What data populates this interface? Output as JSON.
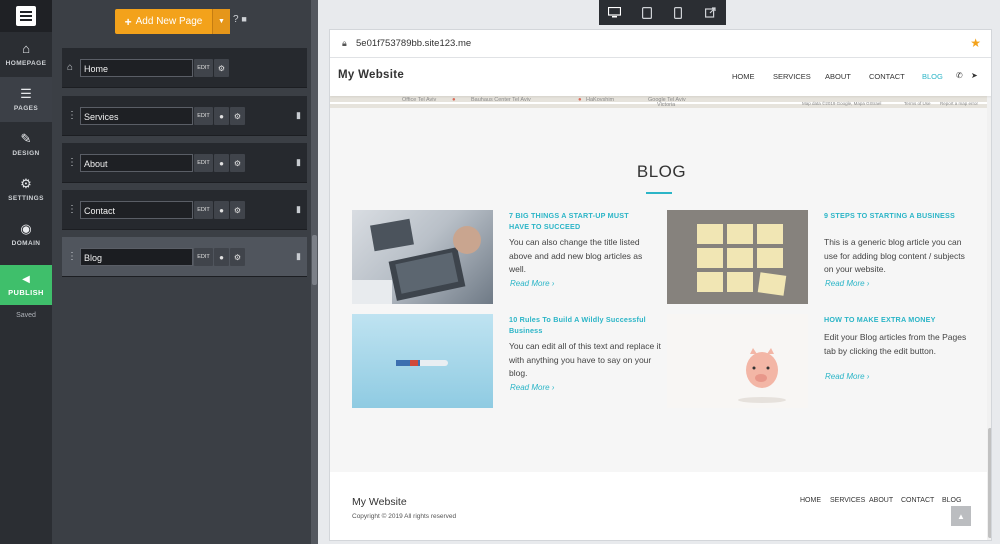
{
  "rail": {
    "items": [
      {
        "label": "HOMEPAGE",
        "icon": "home-icon"
      },
      {
        "label": "PAGES",
        "icon": "pages-icon"
      },
      {
        "label": "DESIGN",
        "icon": "brush-icon"
      },
      {
        "label": "SETTINGS",
        "icon": "gear-icon"
      },
      {
        "label": "DOMAIN",
        "icon": "globe-icon"
      }
    ],
    "publish_label": "PUBLISH",
    "saved_label": "Saved"
  },
  "pages_panel": {
    "add_label": "Add New Page",
    "edit_label": "EDIT",
    "pages": [
      {
        "name": "Home"
      },
      {
        "name": "Services"
      },
      {
        "name": "About"
      },
      {
        "name": "Contact"
      },
      {
        "name": "Blog"
      }
    ]
  },
  "browser": {
    "url": "5e01f753789bb.site123.me"
  },
  "site": {
    "title": "My Website",
    "nav": [
      "HOME",
      "SERVICES",
      "ABOUT",
      "CONTACT",
      "BLOG"
    ],
    "map_labels": [
      "Office Tel Aviv",
      "Bauhaus Center Tel Aviv",
      "HaKovshim",
      "Google Tel Aviv",
      "Victoria",
      "Map data ©2019 Google, Mapa GISrael",
      "Terms of Use",
      "Report a map error"
    ],
    "blog_heading": "BLOG",
    "posts": [
      {
        "title": "7 BIG THINGS A START-UP MUST HAVE TO SUCCEED",
        "body": "You can also change the title listed above and add new blog articles as well.",
        "more": "Read More ›"
      },
      {
        "title": "9 STEPS TO STARTING A BUSINESS",
        "body": "This is a generic blog article you can use for adding blog content / subjects on your website.",
        "more": "Read More ›"
      },
      {
        "title": "10 Rules To Build A Wildly Successful Business",
        "body": "You can edit all of this text and replace it with anything you have to say on your blog.",
        "more": "Read More ›"
      },
      {
        "title": "HOW TO MAKE EXTRA MONEY",
        "body": "Edit your Blog articles from the Pages tab by clicking the edit button.",
        "more": "Read More ›"
      }
    ],
    "footer": {
      "title": "My Website",
      "copyright": "Copyright © 2019 All rights reserved",
      "links": [
        "HOME",
        "SERVICES",
        "ABOUT",
        "CONTACT",
        "BLOG"
      ]
    }
  },
  "colors": {
    "accent": "#2bb5c7",
    "add_button": "#f3a21b",
    "publish": "#3fbf6b"
  }
}
